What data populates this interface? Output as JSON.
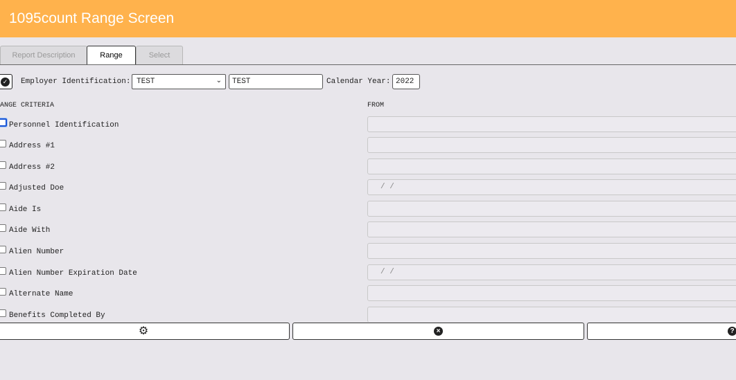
{
  "header": {
    "title": "1095count Range Screen"
  },
  "tabs": [
    {
      "label": "Report Description",
      "active": false
    },
    {
      "label": "Range",
      "active": true
    },
    {
      "label": "Select",
      "active": false
    }
  ],
  "filters": {
    "employer_label": "Employer Identification:",
    "employer_select_value": "TEST",
    "employer_text_value": "TEST",
    "year_label": "Calendar Year:",
    "year_value": "2022"
  },
  "columns": {
    "criteria": "RANGE CRITERIA",
    "from": "FROM"
  },
  "criteria": [
    {
      "label": "Personnel Identification",
      "from_value": ""
    },
    {
      "label": "Address #1",
      "from_value": ""
    },
    {
      "label": "Address #2",
      "from_value": ""
    },
    {
      "label": "Adjusted Doe",
      "from_value": " /  /"
    },
    {
      "label": "Aide Is",
      "from_value": ""
    },
    {
      "label": "Aide With",
      "from_value": ""
    },
    {
      "label": "Alien Number",
      "from_value": ""
    },
    {
      "label": "Alien Number Expiration Date",
      "from_value": " /  /"
    },
    {
      "label": "Alternate Name",
      "from_value": ""
    },
    {
      "label": "Benefits Completed By",
      "from_value": ""
    }
  ],
  "buttons": {
    "settings_icon": "gear-icon",
    "cancel_icon": "close-circle-icon",
    "help_icon": "question-circle-icon"
  },
  "colors": {
    "header_bg": "#ffb24c",
    "page_bg": "#e8e6eb"
  }
}
